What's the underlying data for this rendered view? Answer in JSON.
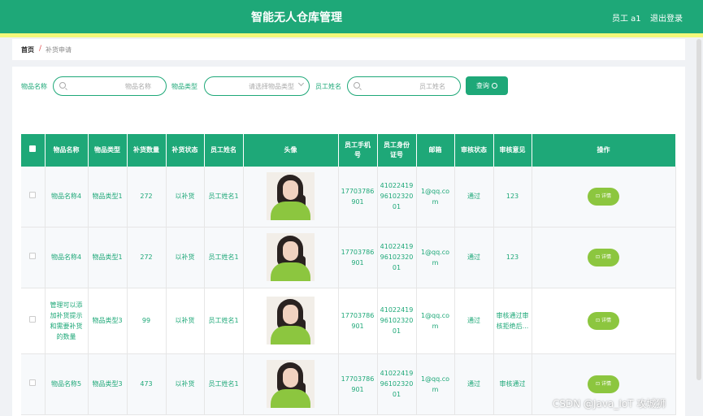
{
  "header": {
    "title": "智能无人仓库管理",
    "user": "员工 a1",
    "logout": "退出登录"
  },
  "breadcrumb": {
    "home": "首页",
    "separator": "/",
    "current": "补货申请"
  },
  "search": {
    "item_name_label": "物品名称",
    "item_name_placeholder": "物品名称",
    "item_type_label": "物品类型",
    "item_type_placeholder": "请选择物品类型",
    "employee_label": "员工姓名",
    "employee_placeholder": "员工姓名",
    "query_label": "查询"
  },
  "table": {
    "headers": [
      "物品名称",
      "物品类型",
      "补货数量",
      "补货状态",
      "员工姓名",
      "头像",
      "员工手机号",
      "员工身份证号",
      "邮箱",
      "审核状态",
      "审核意见",
      "操作"
    ],
    "rows": [
      {
        "name": "物品名称4",
        "type": "物品类型1",
        "qty": "272",
        "status": "以补货",
        "employee": "员工姓名1",
        "phone": "17703786901",
        "idcard": "410224199610232001",
        "email": "1@qq.com",
        "audit": "通过",
        "opinion": "123"
      },
      {
        "name": "物品名称4",
        "type": "物品类型1",
        "qty": "272",
        "status": "以补货",
        "employee": "员工姓名1",
        "phone": "17703786901",
        "idcard": "410224199610232001",
        "email": "1@qq.com",
        "audit": "通过",
        "opinion": "123"
      },
      {
        "name": "管理可以添加补货提示 和需要补货的数量",
        "type": "物品类型3",
        "qty": "99",
        "status": "以补货",
        "employee": "员工姓名1",
        "phone": "17703786901",
        "idcard": "410224199610232001",
        "email": "1@qq.com",
        "audit": "通过",
        "opinion": "审核通过审核拒绝后..."
      },
      {
        "name": "物品名称5",
        "type": "物品类型3",
        "qty": "473",
        "status": "以补货",
        "employee": "员工姓名1",
        "phone": "17703786901",
        "idcard": "410224199610232001",
        "email": "1@qq.com",
        "audit": "通过",
        "opinion": "审核通过"
      }
    ],
    "detail_label": "详情"
  },
  "watermark": "CSDN @Java_IoT 攻城狮",
  "colors": {
    "primary": "#1ea878",
    "accent_strip": "#f3f87a",
    "detail_button": "#8cc63f"
  }
}
